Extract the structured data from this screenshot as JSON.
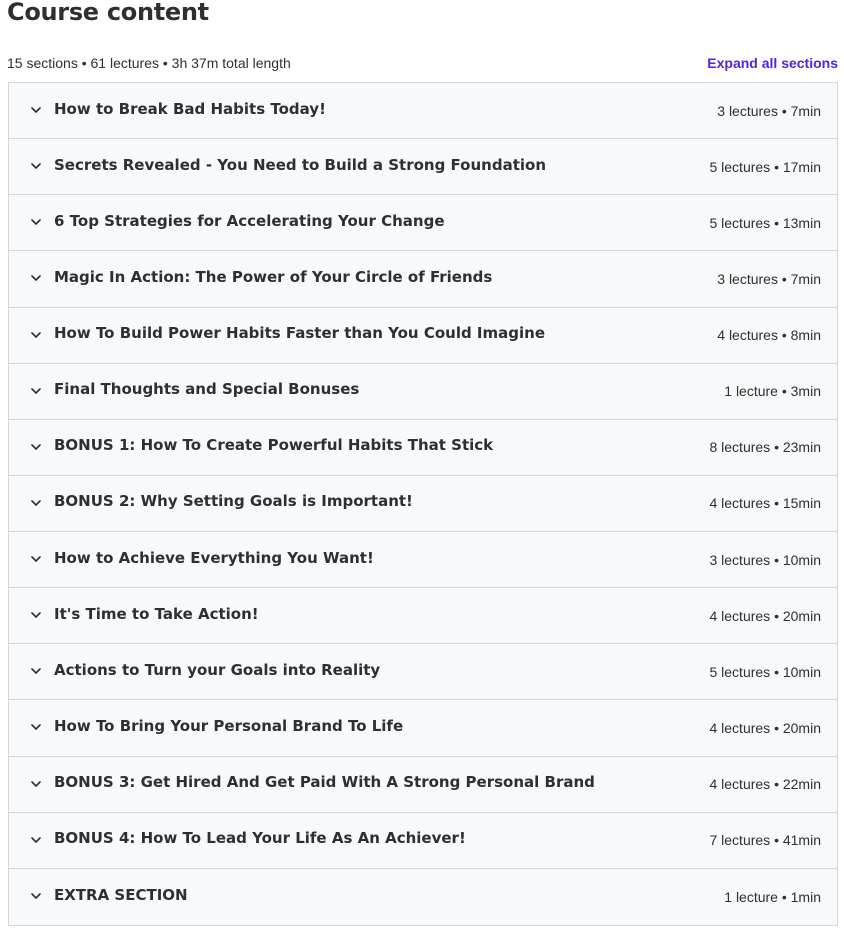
{
  "header": {
    "title": "Course content",
    "summary": "15 sections • 61 lectures • 3h 37m total length",
    "expand_all_label": "Expand all sections"
  },
  "sections": [
    {
      "title": "How to Break Bad Habits Today!",
      "meta": "3 lectures • 7min"
    },
    {
      "title": "Secrets Revealed - You Need to Build a Strong Foundation",
      "meta": "5 lectures • 17min"
    },
    {
      "title": "6 Top Strategies for Accelerating Your Change",
      "meta": "5 lectures • 13min"
    },
    {
      "title": "Magic In Action: The Power of Your Circle of Friends",
      "meta": "3 lectures • 7min"
    },
    {
      "title": "How To Build Power Habits Faster than You Could Imagine",
      "meta": "4 lectures • 8min"
    },
    {
      "title": "Final Thoughts and Special Bonuses",
      "meta": "1 lecture • 3min"
    },
    {
      "title": "BONUS 1: How To Create Powerful Habits That Stick",
      "meta": "8 lectures • 23min"
    },
    {
      "title": "BONUS 2: Why Setting Goals is Important!",
      "meta": "4 lectures • 15min"
    },
    {
      "title": "How to Achieve Everything You Want!",
      "meta": "3 lectures • 10min"
    },
    {
      "title": "It's Time to Take Action!",
      "meta": "4 lectures • 20min"
    },
    {
      "title": "Actions to Turn your Goals into Reality",
      "meta": "5 lectures • 10min"
    },
    {
      "title": "How To Bring Your Personal Brand To Life",
      "meta": "4 lectures • 20min"
    },
    {
      "title": "BONUS 3: Get Hired And Get Paid With A Strong Personal Brand",
      "meta": "4 lectures • 22min"
    },
    {
      "title": "BONUS 4: How To Lead Your Life As An Achiever!",
      "meta": "7 lectures • 41min"
    },
    {
      "title": "EXTRA SECTION",
      "meta": "1 lecture • 1min"
    }
  ],
  "icons": {
    "section_toggle": "chevron-down-icon"
  },
  "colors": {
    "accent": "#5624d0",
    "text": "#2d2f31",
    "section_bg": "#f7f9fa",
    "border": "#d1d7dc"
  }
}
